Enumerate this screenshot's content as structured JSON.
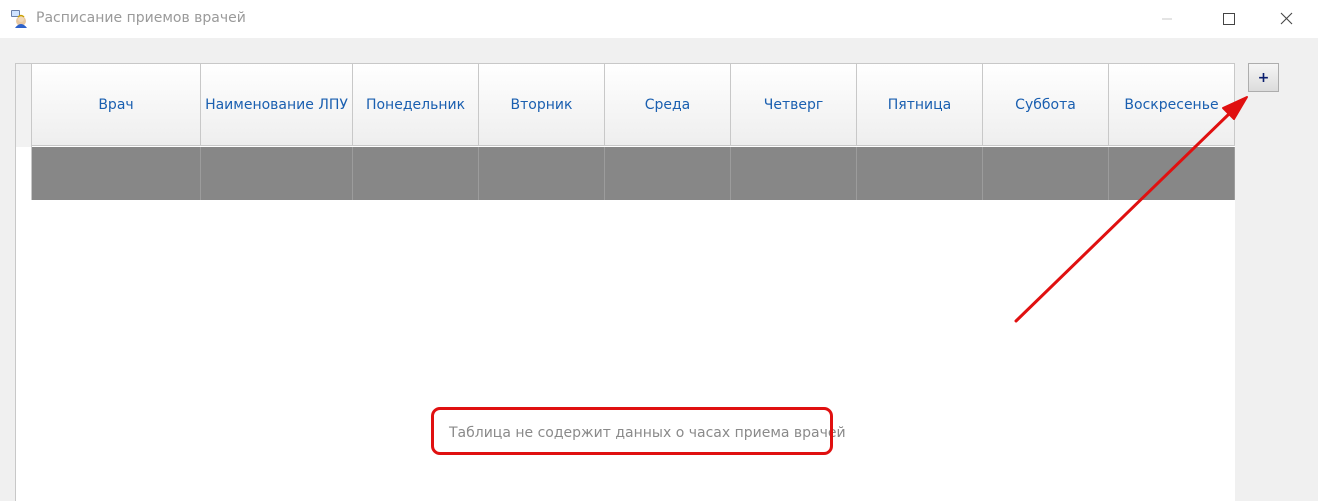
{
  "window": {
    "title": "Расписание приемов врачей"
  },
  "table": {
    "columns": [
      {
        "label": "Врач"
      },
      {
        "label": "Наименование ЛПУ"
      },
      {
        "label": "Понедельник"
      },
      {
        "label": "Вторник"
      },
      {
        "label": "Среда"
      },
      {
        "label": "Четверг"
      },
      {
        "label": "Пятница"
      },
      {
        "label": "Суббота"
      },
      {
        "label": "Воскресенье"
      }
    ],
    "empty_message": "Таблица не содержит данных о часах приема врачей"
  },
  "toolbar": {
    "add_label": "+"
  },
  "colors": {
    "header_text": "#1a5fb0",
    "selected_row": "#878787",
    "annotation": "#e01010"
  }
}
